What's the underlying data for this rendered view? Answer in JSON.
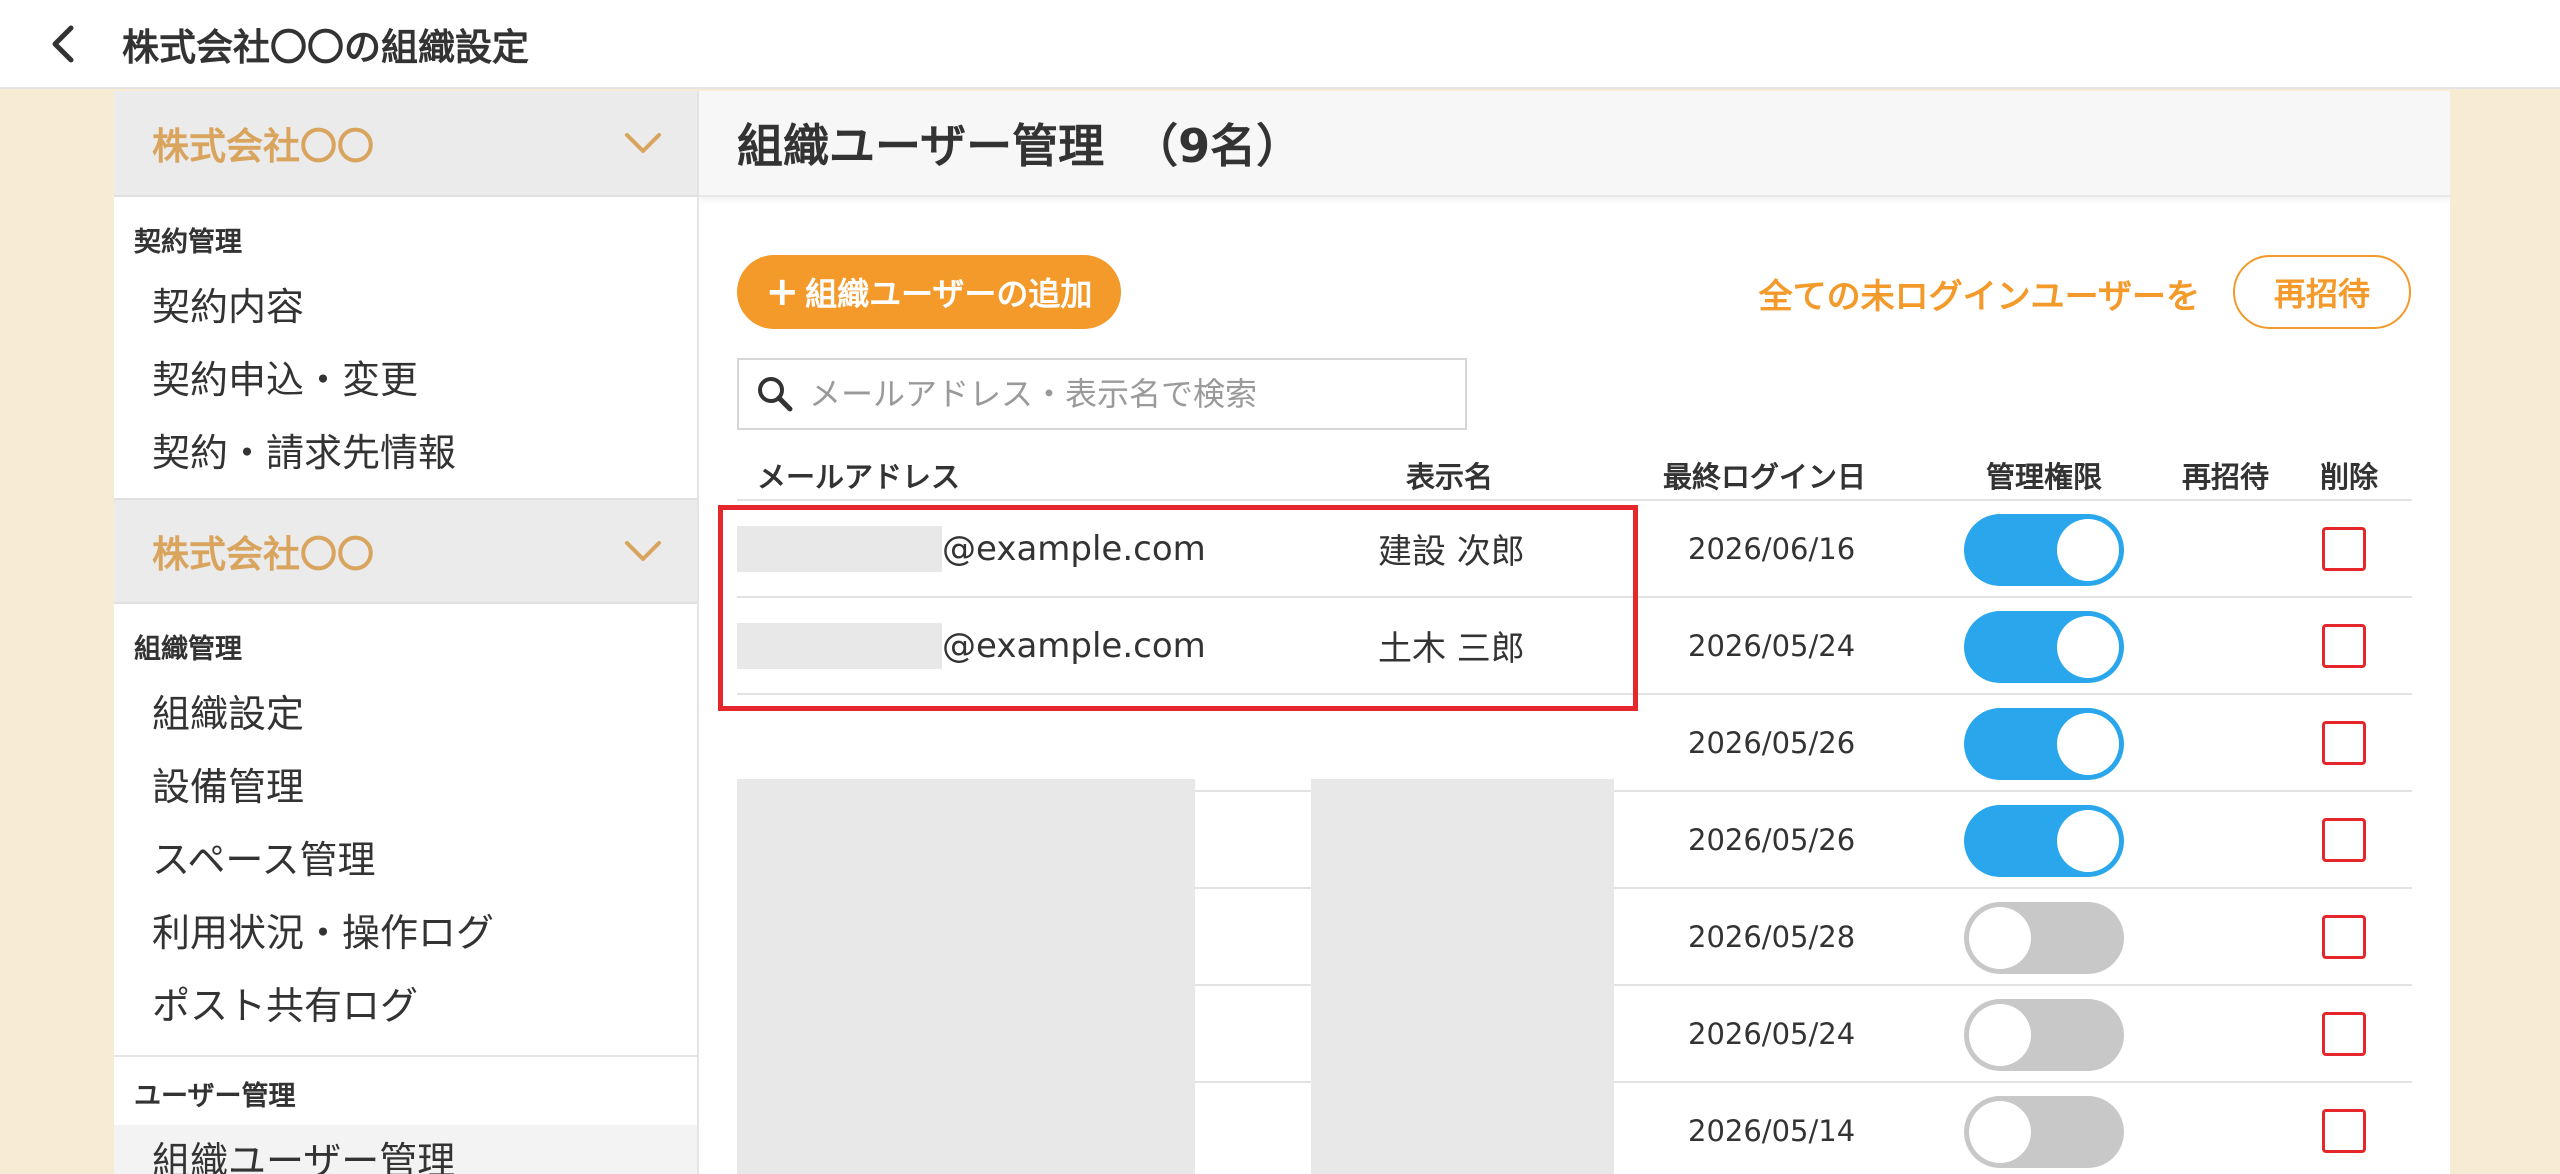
{
  "topbar": {
    "title": "株式会社〇〇の組織設定",
    "back_icon": "chevron-left-icon"
  },
  "sidebar": {
    "org_groups": [
      {
        "org_name": "株式会社〇〇",
        "sections": [
          {
            "label": "契約管理",
            "items": [
              "契約内容",
              "契約申込・変更",
              "契約・請求先情報"
            ]
          }
        ]
      },
      {
        "org_name": "株式会社〇〇",
        "sections": [
          {
            "label": "組織管理",
            "items": [
              "組織設定",
              "設備管理",
              "スペース管理",
              "利用状況・操作ログ",
              "ポスト共有ログ"
            ]
          },
          {
            "label": "ユーザー管理",
            "items": [
              "組織ユーザー管理"
            ]
          }
        ]
      }
    ],
    "active_item": "組織ユーザー管理"
  },
  "main": {
    "title": "組織ユーザー管理",
    "count": "（9名）",
    "add_button_label": "組織ユーザーの追加",
    "reinvite_all_label": "全ての未ログインユーザーを",
    "reinvite_all_button": "再招待",
    "search": {
      "placeholder": "メールアドレス・表示名で検索",
      "value": ""
    },
    "table": {
      "headers": {
        "email": "メールアドレス",
        "display_name": "表示名",
        "last_login": "最終ログイン日",
        "admin": "管理権限",
        "reinvite": "再招待",
        "delete": "削除"
      },
      "rows": [
        {
          "email": "@example.com",
          "display_name": "建設 次郎",
          "last_login": "2026/06/16",
          "admin": true,
          "delete_checked": false
        },
        {
          "email": "@example.com",
          "display_name": "土木 三郎",
          "last_login": "2026/05/24",
          "admin": true,
          "delete_checked": false
        },
        {
          "email": "",
          "display_name": "",
          "last_login": "2026/05/26",
          "admin": true,
          "delete_checked": false
        },
        {
          "email": "",
          "display_name": "",
          "last_login": "2026/05/26",
          "admin": true,
          "delete_checked": false
        },
        {
          "email": "",
          "display_name": "",
          "last_login": "2026/05/28",
          "admin": false,
          "delete_checked": false
        },
        {
          "email": "",
          "display_name": "",
          "last_login": "2026/05/24",
          "admin": false,
          "delete_checked": false
        },
        {
          "email": "",
          "display_name": "",
          "last_login": "2026/05/14",
          "admin": false,
          "delete_checked": false
        }
      ]
    }
  },
  "colors": {
    "accent_orange": "#f39a2b",
    "org_name_tan": "#d9a45e",
    "toggle_on": "#2aa7ec",
    "toggle_off": "#c8c8c8",
    "delete_red": "#e5262b",
    "page_bg": "#f8ebd4"
  }
}
